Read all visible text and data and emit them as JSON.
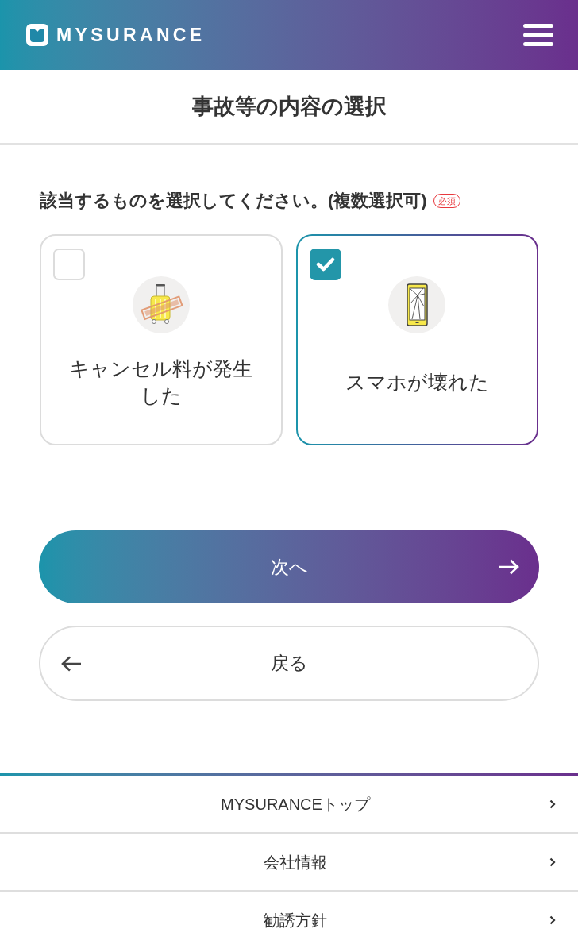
{
  "header": {
    "logo": "MYSURANCE"
  },
  "title": "事故等の内容の選択",
  "question": {
    "label": "該当するものを選択してください。(複数選択可)",
    "required_badge": "必須"
  },
  "options": [
    {
      "kind": "cancel",
      "label": "キャンセル料が発生した",
      "checked": false
    },
    {
      "kind": "phone",
      "label": "スマホが壊れた",
      "checked": true
    }
  ],
  "buttons": [
    {
      "kind": "next",
      "label": "次へ"
    },
    {
      "kind": "back",
      "label": "戻る"
    }
  ],
  "footer_links": [
    "MYSURANCEトップ",
    "会社情報",
    "勧誘方針"
  ]
}
